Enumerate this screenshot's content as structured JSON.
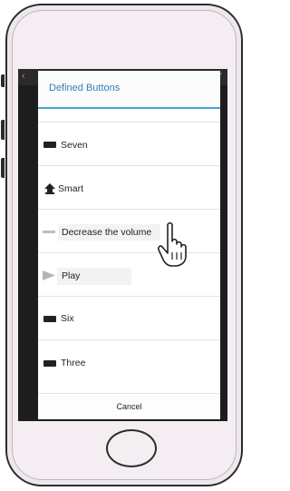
{
  "dialog": {
    "title": "Defined Buttons",
    "cancel_label": "Cancel",
    "items": [
      {
        "label": "Seven",
        "icon": "key-icon"
      },
      {
        "label": "Smart",
        "icon": "eject-icon"
      },
      {
        "label": "Decrease the volume",
        "icon": "minus-icon"
      },
      {
        "label": "Play",
        "icon": "play-icon"
      },
      {
        "label": "Six",
        "icon": "key-icon"
      },
      {
        "label": "Three",
        "icon": "key-icon"
      }
    ]
  },
  "colors": {
    "accent": "#3fa7d8",
    "title_text": "#2f7fc1",
    "phone_body": "#efe7ee",
    "screen_bg": "#1d1d1d"
  }
}
